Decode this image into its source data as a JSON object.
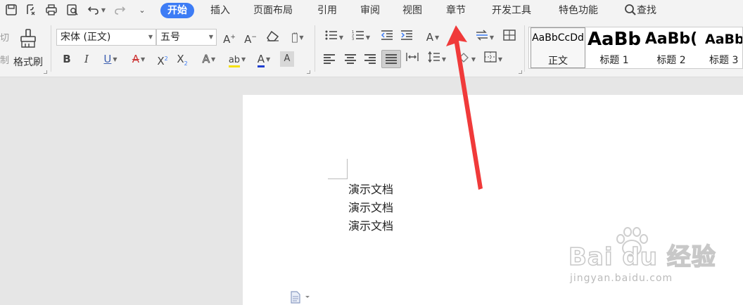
{
  "menu": {
    "tabs": [
      {
        "label": "开始",
        "active": true
      },
      {
        "label": "插入"
      },
      {
        "label": "页面布局"
      },
      {
        "label": "引用"
      },
      {
        "label": "审阅"
      },
      {
        "label": "视图"
      },
      {
        "label": "章节"
      },
      {
        "label": "开发工具"
      },
      {
        "label": "特色功能"
      }
    ],
    "search_label": "查找",
    "accent_color": "#3d7cf5"
  },
  "ribbon": {
    "cut_label": "切",
    "paste_label": "制",
    "format_painter_label": "格式刷",
    "font_name": "宋体 (正文)",
    "font_size": "五号",
    "styles": [
      {
        "sample": "AaBbCcDd",
        "label": "正文",
        "selected": true
      },
      {
        "sample": "AaBb",
        "label": "标题 1"
      },
      {
        "sample": "AaBb(",
        "label": "标题 2"
      },
      {
        "sample": "AaBb",
        "label": "标题 3"
      }
    ]
  },
  "document": {
    "lines": [
      "演示文档",
      "演示文档",
      "演示文档"
    ]
  },
  "watermark": {
    "main": "Bai du 经验",
    "sub": "jingyan.baidu.com"
  },
  "annotation": {
    "arrow_color": "#f03a3a"
  }
}
